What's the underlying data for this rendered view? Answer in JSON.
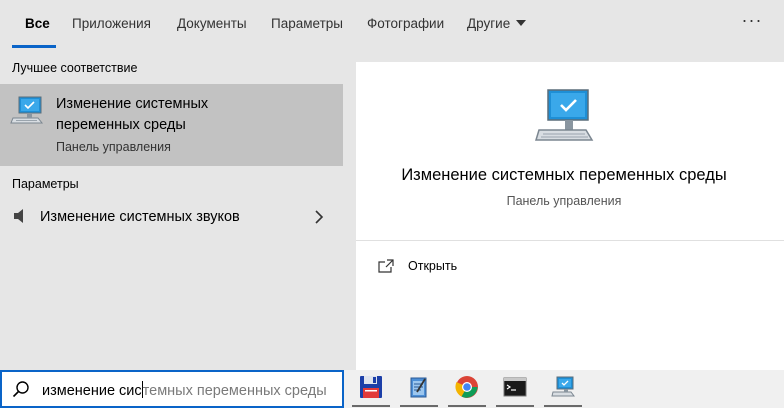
{
  "tabs": [
    {
      "label": "Все",
      "active": true
    },
    {
      "label": "Приложения",
      "active": false
    },
    {
      "label": "Документы",
      "active": false
    },
    {
      "label": "Параметры",
      "active": false
    },
    {
      "label": "Фотографии",
      "active": false
    },
    {
      "label": "Другие",
      "active": false
    }
  ],
  "tabs_more_symbol": "···",
  "best_match": {
    "heading": "Лучшее соответствие",
    "title_line1": "Изменение системных",
    "title_line2": "переменных среды",
    "subtitle": "Панель управления",
    "icon": "computer-settings-icon"
  },
  "settings_section": {
    "heading": "Параметры",
    "items": [
      {
        "label": "Изменение системных звуков",
        "icon": "speaker-icon"
      }
    ]
  },
  "preview": {
    "title": "Изменение системных переменных среды",
    "subtitle": "Панель управления",
    "icon": "computer-settings-icon",
    "actions": [
      {
        "label": "Открыть",
        "icon": "open-icon"
      }
    ]
  },
  "search": {
    "typed": "изменение сис",
    "suggestion": "темных переменных среды",
    "icon": "search-icon"
  },
  "taskbar": {
    "apps": [
      {
        "name": "floppy-save-icon",
        "running": true
      },
      {
        "name": "notepad-app-icon",
        "running": true
      },
      {
        "name": "chrome-icon",
        "running": true
      },
      {
        "name": "terminal-icon",
        "running": true
      },
      {
        "name": "system-settings-icon",
        "running": true
      }
    ]
  },
  "colors": {
    "accent": "#0a64c8",
    "best_match_bg": "#c2c2c2",
    "panel_bg": "#e6e6e6",
    "preview_bg": "#ffffff"
  }
}
